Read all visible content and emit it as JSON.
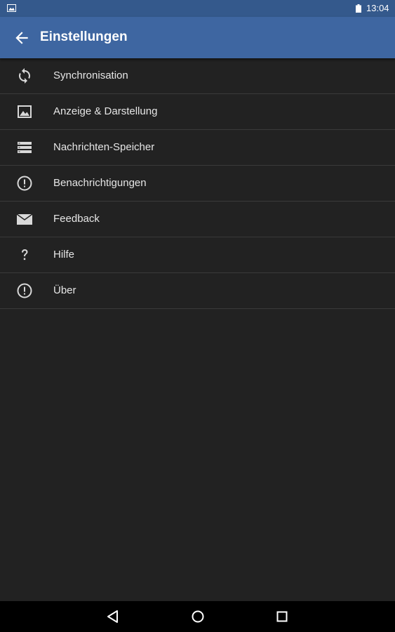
{
  "status_bar": {
    "time": "13:04",
    "icons": [
      "image-notification-icon",
      "battery-icon"
    ]
  },
  "app_bar": {
    "title": "Einstellungen",
    "back_icon": "arrow-back-icon"
  },
  "settings": {
    "items": [
      {
        "label": "Synchronisation",
        "icon": "sync-icon"
      },
      {
        "label": "Anzeige & Darstellung",
        "icon": "image-icon"
      },
      {
        "label": "Nachrichten-Speicher",
        "icon": "storage-icon"
      },
      {
        "label": "Benachrichtigungen",
        "icon": "info-icon"
      },
      {
        "label": "Feedback",
        "icon": "mail-icon"
      },
      {
        "label": "Hilfe",
        "icon": "help-icon"
      },
      {
        "label": "Über",
        "icon": "info-icon"
      }
    ]
  },
  "nav_bar": {
    "icons": [
      "back-triangle-icon",
      "home-circle-icon",
      "recents-square-icon"
    ]
  },
  "colors": {
    "status_bar": "#34598c",
    "app_bar": "#3e66a1",
    "background": "#222222",
    "divider": "#3a3a3a"
  }
}
